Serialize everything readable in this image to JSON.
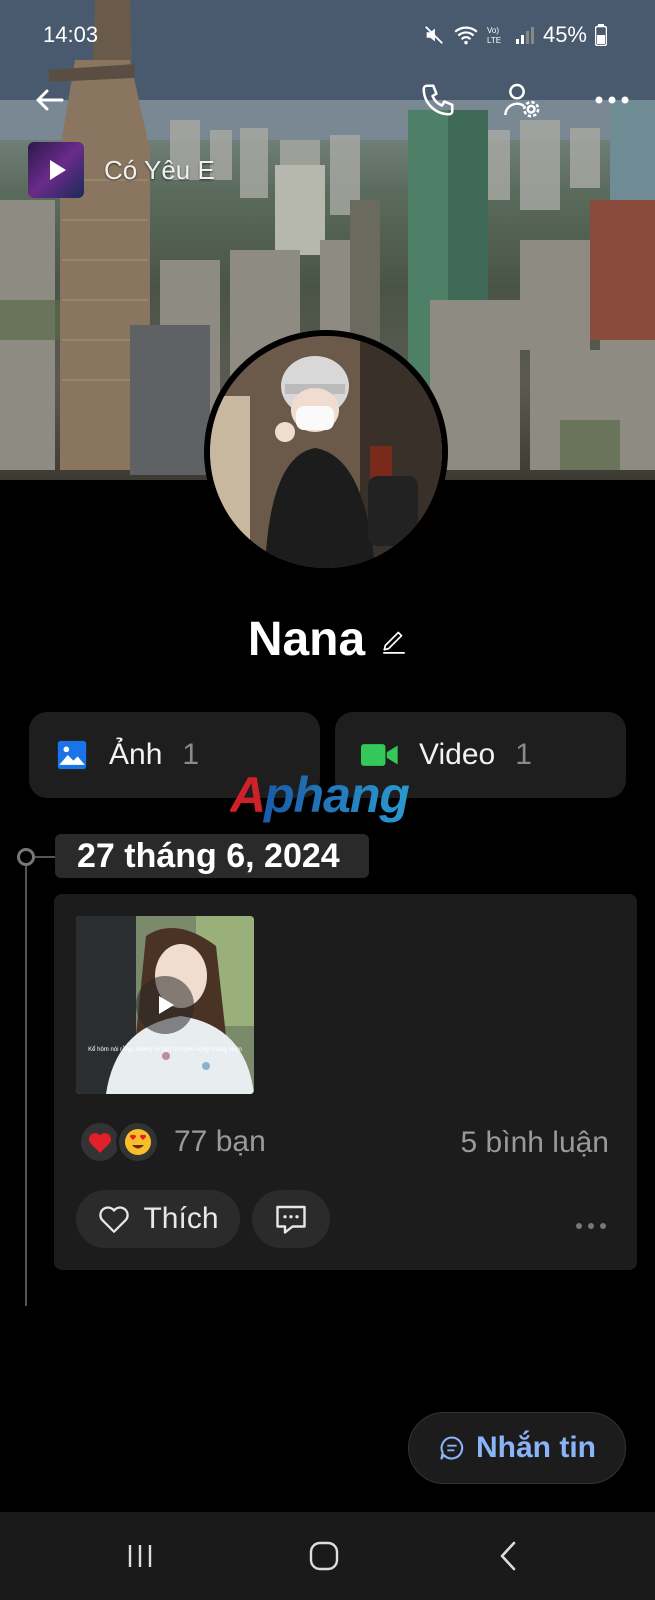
{
  "status_bar": {
    "time": "14:03",
    "battery": "45%"
  },
  "music": {
    "title": "Có Yêu E",
    "icon": "play-icon"
  },
  "profile": {
    "name": "Nana"
  },
  "media": [
    {
      "label": "Ảnh",
      "count": "1",
      "icon": "photo-icon",
      "color": "#1a73e8"
    },
    {
      "label": "Video",
      "count": "1",
      "icon": "video-icon",
      "color": "#34c759"
    }
  ],
  "watermark": {
    "text": "Aphang"
  },
  "timeline": {
    "date": "27 tháng 6, 2024",
    "post": {
      "video_caption": "Kể hôm nói rằng, không có biết tình yêu cũng hoàng khôn",
      "reactions_count": "77 bạn",
      "comments_count": "5 bình luận",
      "like_label": "Thích"
    }
  },
  "message_button": {
    "label": "Nhắn tin"
  },
  "colors": {
    "accent": "#8ab4f8",
    "background": "#000000",
    "card": "#1c1c1c"
  }
}
